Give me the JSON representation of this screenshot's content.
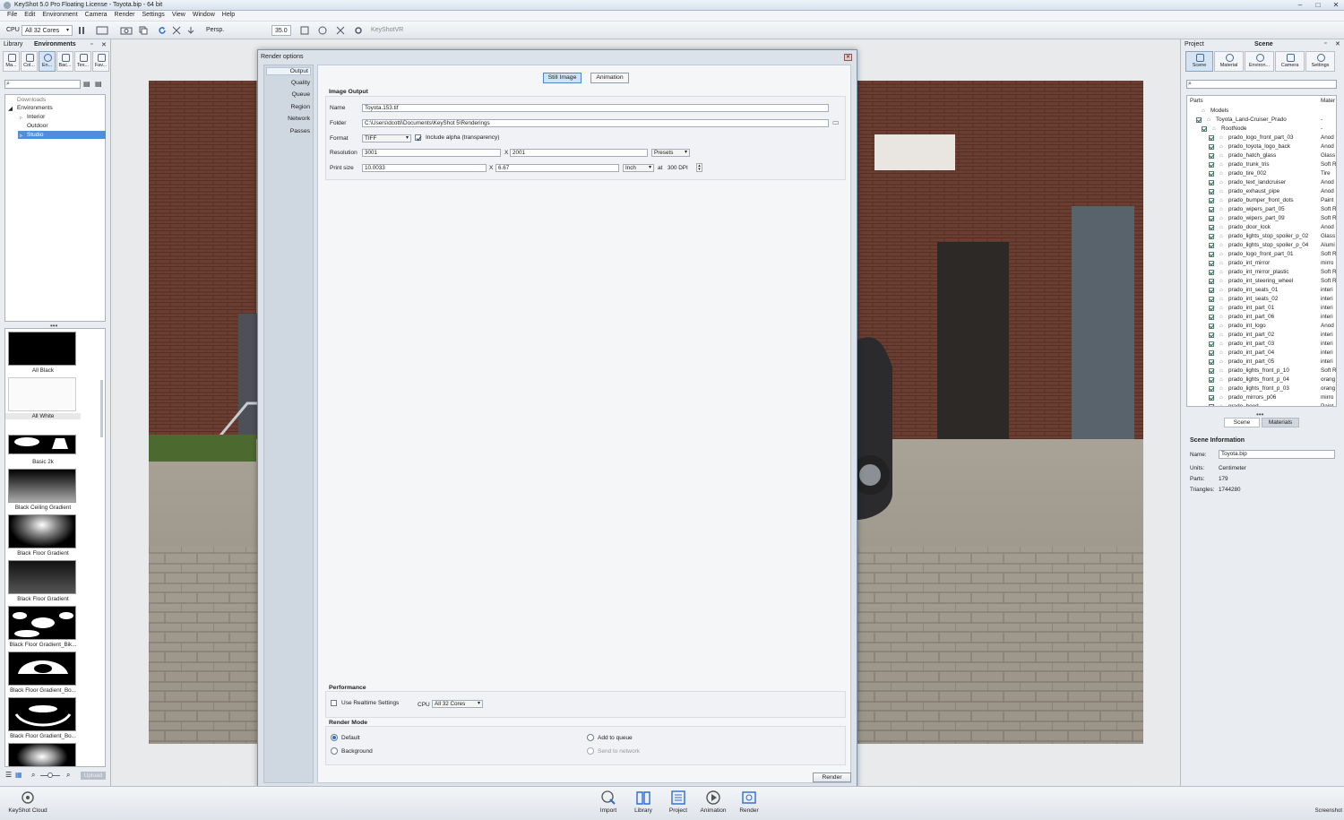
{
  "window": {
    "title": "KeyShot 5.0 Pro Floating License - Toyota.bip - 64 bit"
  },
  "menu": [
    "File",
    "Edit",
    "Environment",
    "Camera",
    "Render",
    "Settings",
    "View",
    "Window",
    "Help"
  ],
  "toolbar": {
    "cpu_label": "CPU",
    "cpu_value": "All 32 Cores",
    "persp_label": "Persp.",
    "fov_value": "35.0",
    "keyshotvr": "KeyShotVR"
  },
  "library": {
    "tab_library": "Library",
    "tab_environments": "Environments",
    "icons": [
      "Ma...",
      "Col...",
      "En...",
      "Bac...",
      "Tex...",
      "Fav..."
    ],
    "tree": [
      "Downloads",
      "Environments",
      "Interior",
      "Outdoor",
      "Studio"
    ],
    "thumbnails": [
      "All Black",
      "All White",
      "Basic 2k",
      "Black Ceiling Gradient",
      "Black Floor Gradient",
      "Black Floor Gradient",
      "Black Floor Gradient_Bik...",
      "Black Floor Gradient_Bo...",
      "Black Floor Gradient_Bo..."
    ],
    "upload": "Upload"
  },
  "render_options": {
    "title": "Render options",
    "nav": [
      "Output",
      "Quality",
      "Queue",
      "Region",
      "Network",
      "Passes"
    ],
    "tabs": {
      "still": "Still Image",
      "animation": "Animation"
    },
    "image_output": {
      "heading": "Image Output",
      "name_label": "Name",
      "name_value": "Toyota.153.tif",
      "folder_label": "Folder",
      "folder_value": "C:\\Users\\dcotti\\Documents\\KeyShot 5\\Renderings",
      "format_label": "Format",
      "format_value": "TIFF",
      "alpha_label": "Include alpha (transparency)",
      "resolution_label": "Resolution",
      "res_w": "3001",
      "res_x": "X",
      "res_h": "2001",
      "presets": "Presets",
      "print_label": "Print size",
      "print_w": "10.0033",
      "print_x": "X",
      "print_h": "6.67",
      "unit": "Inch",
      "at_label": "at",
      "dpi": "300 DPI"
    },
    "performance": {
      "heading": "Performance",
      "realtime_label": "Use Realtime Settings",
      "cpu_label": "CPU",
      "cpu_value": "All 32 Cores"
    },
    "render_mode": {
      "heading": "Render Mode",
      "default": "Default",
      "background": "Background",
      "queue": "Add to queue",
      "network": "Send to network"
    },
    "render_button": "Render"
  },
  "project": {
    "tab_project": "Project",
    "tab_scene": "Scene",
    "icons": [
      "Scene",
      "Material",
      "Environ...",
      "Camera",
      "Settings"
    ],
    "parts_header": "Parts",
    "mat_header": "Mater",
    "tree": [
      {
        "name": "Models",
        "mat": ""
      },
      {
        "name": "Toyota_Land-Cruiser_Prado",
        "mat": "-"
      },
      {
        "name": "RootNode",
        "mat": "-"
      },
      {
        "name": "prado_logo_front_part_03",
        "mat": "Anod"
      },
      {
        "name": "prado_toyota_logo_back",
        "mat": "Anod"
      },
      {
        "name": "prado_hatch_glass",
        "mat": "Glass"
      },
      {
        "name": "prado_trunk_tris",
        "mat": "Soft R"
      },
      {
        "name": "prado_tire_002",
        "mat": "Tire"
      },
      {
        "name": "prado_text_landcruiser",
        "mat": "Anod"
      },
      {
        "name": "prado_exhaust_pipe",
        "mat": "Anod"
      },
      {
        "name": "prado_bumper_front_dots",
        "mat": "Paint"
      },
      {
        "name": "prado_wipers_part_05",
        "mat": "Soft R"
      },
      {
        "name": "prado_wipers_part_09",
        "mat": "Soft R"
      },
      {
        "name": "prado_door_lock",
        "mat": "Anod"
      },
      {
        "name": "prado_lights_stop_spoiler_p_02",
        "mat": "Glass"
      },
      {
        "name": "prado_lights_stop_spoiler_p_04",
        "mat": "Alumi"
      },
      {
        "name": "prado_logo_front_part_01",
        "mat": "Soft R"
      },
      {
        "name": "prado_int_mirror",
        "mat": "mirro"
      },
      {
        "name": "prado_int_mirror_plastic",
        "mat": "Soft R"
      },
      {
        "name": "prado_int_steering_wheel",
        "mat": "Soft R"
      },
      {
        "name": "prado_int_seats_01",
        "mat": "interi"
      },
      {
        "name": "prado_int_seats_02",
        "mat": "interi"
      },
      {
        "name": "prado_int_part_01",
        "mat": "interi"
      },
      {
        "name": "prado_int_part_06",
        "mat": "interi"
      },
      {
        "name": "prado_int_logo",
        "mat": "Anod"
      },
      {
        "name": "prado_int_part_02",
        "mat": "interi"
      },
      {
        "name": "prado_int_part_03",
        "mat": "interi"
      },
      {
        "name": "prado_int_part_04",
        "mat": "interi"
      },
      {
        "name": "prado_int_part_05",
        "mat": "interi"
      },
      {
        "name": "prado_lights_front_p_10",
        "mat": "Soft R"
      },
      {
        "name": "prado_lights_front_p_04",
        "mat": "orang"
      },
      {
        "name": "prado_lights_front_p_03",
        "mat": "orang"
      },
      {
        "name": "prado_mirrors_p06",
        "mat": "mirro"
      },
      {
        "name": "prado_hood",
        "mat": "Paint"
      }
    ],
    "subtab_scene": "Scene",
    "subtab_materials": "Materials",
    "info_heading": "Scene Information",
    "name_label": "Name:",
    "name_value": "Toyota.bip",
    "units_label": "Units:",
    "units_value": "Centimeter",
    "parts_label": "Parts:",
    "parts_value": "179",
    "triangles_label": "Triangles:",
    "triangles_value": "1744280"
  },
  "bottom": {
    "cloud": "KeyShot Cloud",
    "items": [
      "Import",
      "Library",
      "Project",
      "Animation",
      "Render"
    ],
    "screenshot": "Screenshot"
  },
  "colors": {
    "accent": "#2b6dd1",
    "dialog_bg": "#dbe2ea"
  }
}
